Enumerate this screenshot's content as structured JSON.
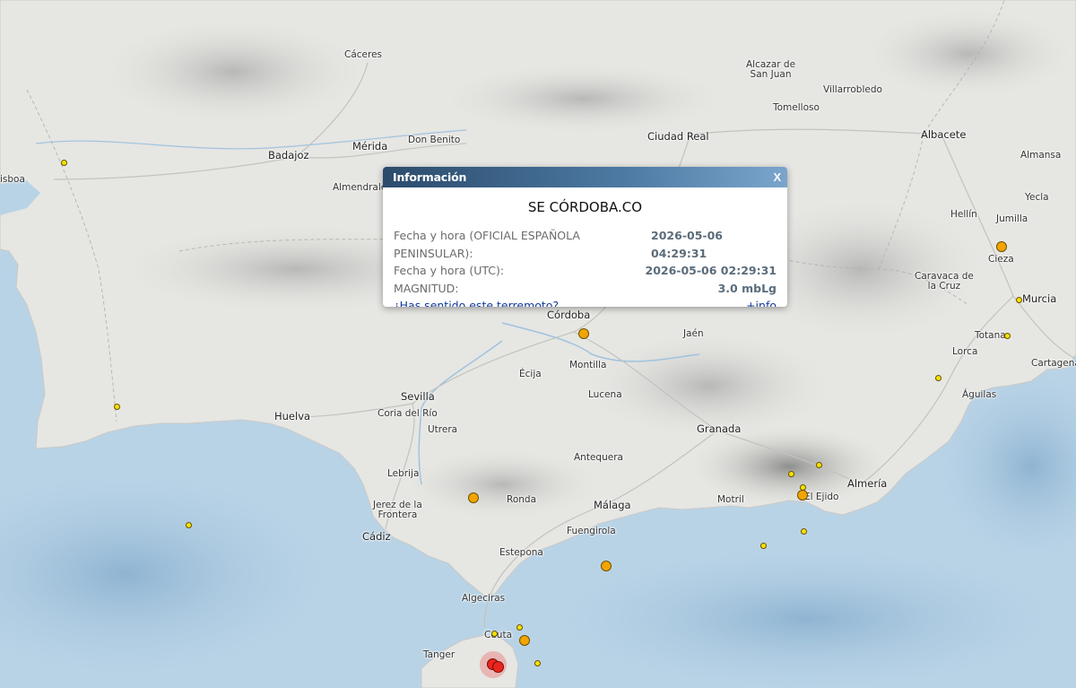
{
  "cities": [
    {
      "name": "Cáceres"
    },
    {
      "name": "Alcazar de\nSan Juan"
    },
    {
      "name": "Villarrobledo"
    },
    {
      "name": "Tomelloso"
    },
    {
      "name": "Mérida"
    },
    {
      "name": "Don Benito"
    },
    {
      "name": "Ciudad Real"
    },
    {
      "name": "Albacete"
    },
    {
      "name": "Badajoz"
    },
    {
      "name": "Almansa"
    },
    {
      "name": "isboa"
    },
    {
      "name": "Almendralejo"
    },
    {
      "name": "Yecla"
    },
    {
      "name": "Hellín"
    },
    {
      "name": "Jumilla"
    },
    {
      "name": "Cieza"
    },
    {
      "name": "Caravaca de\nla Cruz"
    },
    {
      "name": "Murcia"
    },
    {
      "name": "Córdoba"
    },
    {
      "name": "Jaén"
    },
    {
      "name": "Totana"
    },
    {
      "name": "Lorca"
    },
    {
      "name": "Cartagena"
    },
    {
      "name": "Montilla"
    },
    {
      "name": "Écija"
    },
    {
      "name": "Águilas"
    },
    {
      "name": "Sevilla"
    },
    {
      "name": "Lucena"
    },
    {
      "name": "Huelva"
    },
    {
      "name": "Coria del Río"
    },
    {
      "name": "Utrera"
    },
    {
      "name": "Granada"
    },
    {
      "name": "Antequera"
    },
    {
      "name": "Lebrija"
    },
    {
      "name": "Almería"
    },
    {
      "name": "El Ejido"
    },
    {
      "name": "Jerez de la\nFrontera"
    },
    {
      "name": "Ronda"
    },
    {
      "name": "Málaga"
    },
    {
      "name": "Motril"
    },
    {
      "name": "Cádiz"
    },
    {
      "name": "Fuengirola"
    },
    {
      "name": "Estepona"
    },
    {
      "name": "Algeciras"
    },
    {
      "name": "Ceuta"
    },
    {
      "name": "Tanger"
    }
  ],
  "quakes": [
    {
      "type": "small"
    },
    {
      "type": "small"
    },
    {
      "type": "small"
    },
    {
      "type": "med"
    },
    {
      "type": "small"
    },
    {
      "type": "small"
    },
    {
      "type": "med"
    },
    {
      "type": "small"
    },
    {
      "type": "small"
    },
    {
      "type": "med"
    },
    {
      "type": "small"
    },
    {
      "type": "small"
    },
    {
      "type": "med"
    },
    {
      "type": "med"
    },
    {
      "type": "small"
    },
    {
      "type": "small"
    },
    {
      "type": "small"
    },
    {
      "type": "med"
    },
    {
      "type": "red"
    },
    {
      "type": "red"
    }
  ],
  "colors": {
    "sea": "#b9d3e6",
    "land": "#e6e6e3",
    "popup_header": "#2b4b6c",
    "link": "#123a9c",
    "quake_small": "#f4e200",
    "quake_med": "#f2a400",
    "quake_recent": "#e8261f"
  },
  "popup": {
    "title": "Información",
    "close_label": "X",
    "heading": "SE CÓRDOBA.CO",
    "rows": [
      {
        "label": "Fecha y hora (OFICIAL ESPAÑOLA PENINSULAR):",
        "value": "2026-05-06 04:29:31"
      },
      {
        "label": "Fecha y hora (UTC):",
        "value": "2026-05-06 02:29:31"
      },
      {
        "label": "MAGNITUD:",
        "value": "3.0 mbLg"
      }
    ],
    "felt_link": "¿Has sentido este terremoto?",
    "info_link": "+info"
  }
}
